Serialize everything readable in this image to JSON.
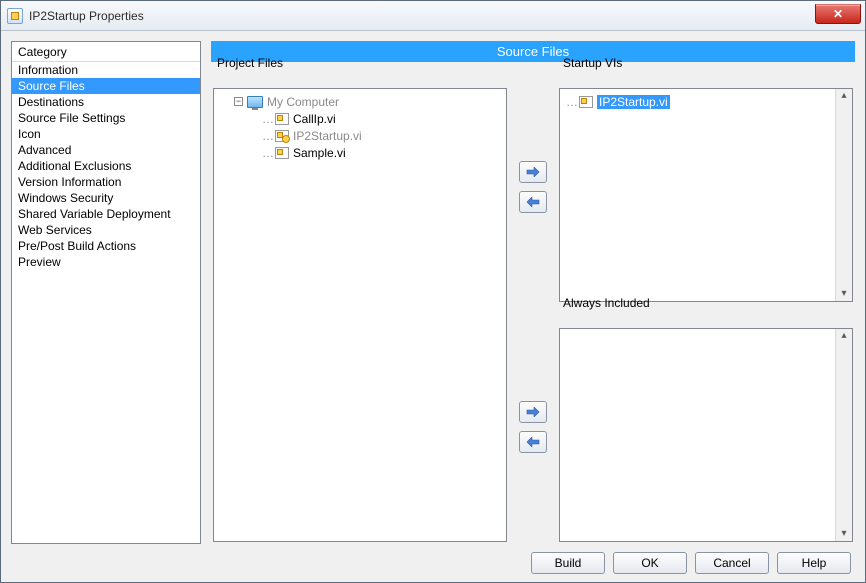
{
  "window": {
    "title": "IP2Startup Properties"
  },
  "category": {
    "header": "Category",
    "items": [
      "Information",
      "Source Files",
      "Destinations",
      "Source File Settings",
      "Icon",
      "Advanced",
      "Additional Exclusions",
      "Version Information",
      "Windows Security",
      "Shared Variable Deployment",
      "Web Services",
      "Pre/Post Build Actions",
      "Preview"
    ],
    "selected_index": 1
  },
  "pane": {
    "title": "Source Files"
  },
  "project": {
    "label": "Project Files",
    "root": "My Computer",
    "files": [
      {
        "name": "CallIp.vi",
        "dim": false
      },
      {
        "name": "IP2Startup.vi",
        "dim": true
      },
      {
        "name": "Sample.vi",
        "dim": false
      }
    ]
  },
  "startup": {
    "label": "Startup VIs",
    "items": [
      "IP2Startup.vi"
    ],
    "selected_index": 0
  },
  "always": {
    "label": "Always Included"
  },
  "buttons": {
    "build": "Build",
    "ok": "OK",
    "cancel": "Cancel",
    "help": "Help"
  },
  "glyphs": {
    "close": "✕",
    "minus": "−",
    "up": "▴",
    "down": "▾"
  }
}
